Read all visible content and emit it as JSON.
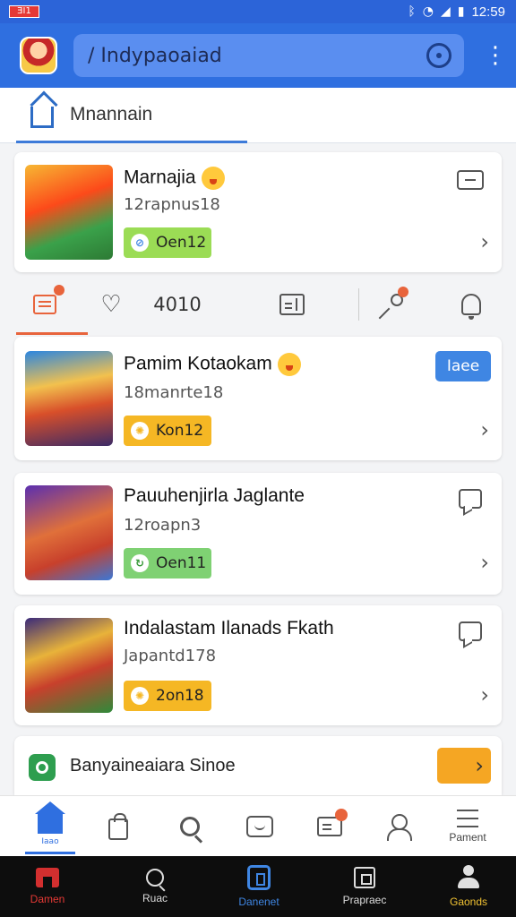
{
  "status_bar": {
    "carrier_badge": "ƎI1",
    "time": "12:59",
    "icons": [
      "bluetooth-icon",
      "wifi-icon",
      "signal-icon",
      "battery-icon"
    ]
  },
  "app_bar": {
    "search_text": "/ Indypaoaiad",
    "icons": [
      "app-logo",
      "search-icon",
      "more-vert-icon"
    ]
  },
  "tab": {
    "label": "Mnannain",
    "icon": "home-icon"
  },
  "featured": {
    "title": "Marnajia",
    "subtitle": "12rapnus18",
    "badge": "Oen12",
    "badge_color": "#9bdc55",
    "icon": "message-icon"
  },
  "filter_row": {
    "count": "4010",
    "accent": "#e8643c",
    "icons": [
      "list-icon",
      "heart-icon",
      "document-icon",
      "key-icon",
      "bell-icon"
    ]
  },
  "apps": [
    {
      "title": "Pamim Kotaokam",
      "subtitle": "18manrte18",
      "badge": "Kon12",
      "badge_color": "#f5b724",
      "action": "Iaee"
    },
    {
      "title": "Pauuhenjirla Jaglante",
      "subtitle": "12roapn3",
      "badge": "Oen11",
      "badge_color": "#7fd173",
      "action_icon": "chat-icon"
    },
    {
      "title": "Indalastam Ilanads Fkath",
      "subtitle": "Japantd178",
      "badge": "2on18",
      "badge_color": "#f5b724",
      "action_icon": "chat-icon"
    }
  ],
  "banner": {
    "text": "Banyaineaiara Sinoe",
    "button_color": "#f5a623"
  },
  "nav_primary": {
    "active_label": "Iaao",
    "last_label": "Pament",
    "accent": "#2f6fe0",
    "icons": [
      "home-icon",
      "shopping-bag-icon",
      "search-icon",
      "inbox-icon",
      "card-icon",
      "person-icon",
      "stack-icon"
    ]
  },
  "nav_secondary": {
    "items": [
      {
        "label": "Damen",
        "color": "#e53935"
      },
      {
        "label": "Ruac",
        "color": "#dddddd"
      },
      {
        "label": "Danenet",
        "color": "#3f86e3"
      },
      {
        "label": "Prapraec",
        "color": "#dddddd"
      },
      {
        "label": "Gaonds",
        "color": "#f1c232"
      }
    ]
  }
}
